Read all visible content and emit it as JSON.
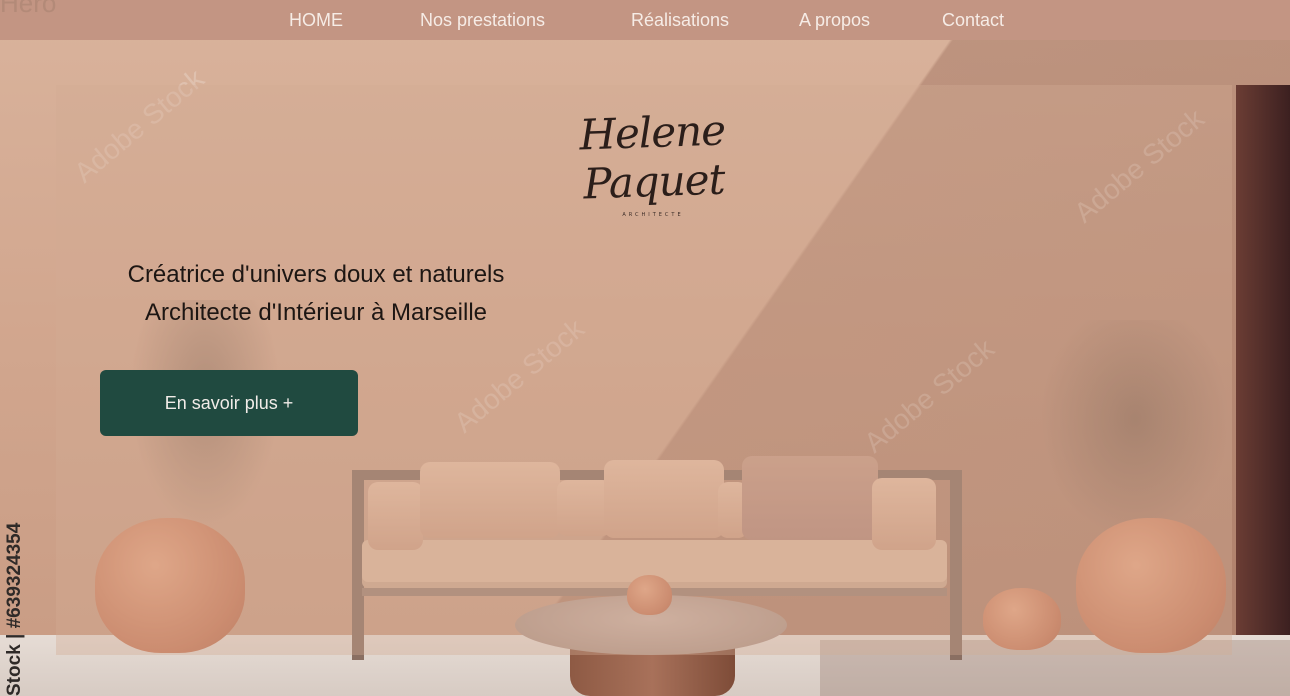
{
  "nav": {
    "brand_fragment": "Hero",
    "items": [
      "HOME",
      "Nos prestations",
      "Réalisations",
      "A propos",
      "Contact"
    ]
  },
  "logo": {
    "name": "Helene Paquet",
    "subtitle": "ARCHITECTE"
  },
  "hero": {
    "tagline_line1": "Créatrice d'univers doux et naturels",
    "tagline_line2": "Architecte d'Intérieur à Marseille",
    "cta_label": "En savoir plus +"
  },
  "watermark": {
    "stock_id": "Stock | #639324354",
    "text": "Adobe Stock"
  },
  "colors": {
    "nav_bg": "#c39583",
    "cta_bg": "#204a40",
    "text_dark": "#1d1613"
  }
}
